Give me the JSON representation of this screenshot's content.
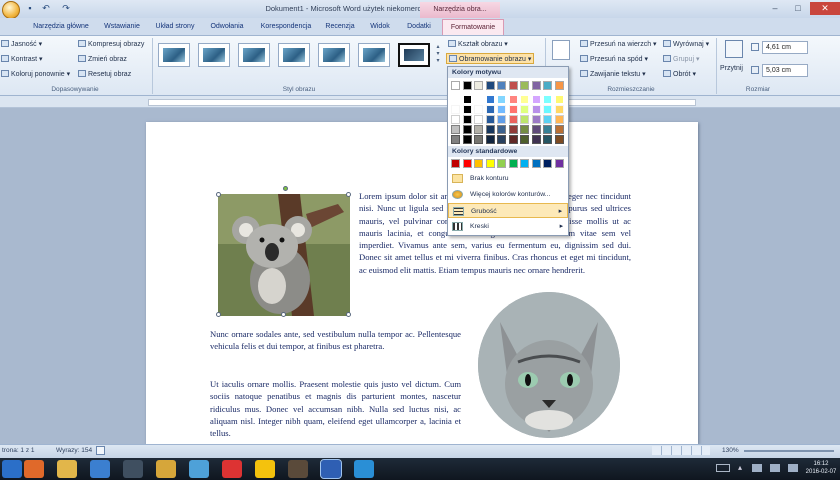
{
  "window": {
    "title": "Dokument1 - Microsoft Word użytek niekomercyjny",
    "context_title": "Narzędzia obra...",
    "colors": {
      "ribbon": "#dde7f3",
      "context_tab": "#fbe9f0",
      "close": "#c9463d",
      "document_text": "#1a2a66",
      "hover_menu": "#fde9b8"
    }
  },
  "tabs": [
    "Narzędzia główne",
    "Wstawianie",
    "Układ strony",
    "Odwołania",
    "Korespondencja",
    "Recenzja",
    "Widok",
    "Dodatki",
    "Formatowanie"
  ],
  "ribbon": {
    "adjust": {
      "brightness": "Jasność",
      "contrast": "Kontrast",
      "recolor": "Koloruj ponownie",
      "compress": "Kompresuj obrazy",
      "change": "Zmień obraz",
      "reset": "Resetuj obraz",
      "label": "Dopasowywanie"
    },
    "styles": {
      "label": "Styl obrazu"
    },
    "shape_border": {
      "shape": "Kształt obrazu",
      "border": "Obramowanie obrazu"
    },
    "arrange": {
      "bring_front": "Przesuń na wierzch",
      "send_back": "Przesuń na spód",
      "wrap": "Zawijanie tekstu",
      "align": "Wyrównaj",
      "group": "Grupuj",
      "rotate": "Obrót",
      "position": "Położenie",
      "label": "Rozmieszczanie"
    },
    "size": {
      "crop": "Przytnij",
      "height": "4,61 cm",
      "width": "5,03 cm",
      "label": "Rozmiar"
    }
  },
  "dropdown": {
    "theme_colors": "Kolory motywu",
    "standard_colors": "Kolory standardowe",
    "no_outline": "Brak konturu",
    "more_colors": "Więcej kolorów konturów...",
    "weight": "Grubość",
    "dashes": "Kreski",
    "theme_top": [
      "#ffffff",
      "#000000",
      "#eeece1",
      "#1f497d",
      "#4f81bd",
      "#c0504d",
      "#9bbb59",
      "#8064a2",
      "#4bacc6",
      "#f79646"
    ],
    "standard": [
      "#c00000",
      "#ff0000",
      "#ffc000",
      "#ffff00",
      "#92d050",
      "#00b050",
      "#00b0f0",
      "#0070c0",
      "#002060",
      "#7030a0"
    ]
  },
  "document": {
    "para1": [
      {
        "t": "Lorem ipsum dolor sit amet, consectetur adipiscing elit. Integer nec tincidunt nisi. Nunc ut ligula sed mauris in pulvinar condimentum, purus sed ultrices mauris, vel pulvinar convallis ante est eu risus. Suspendisse mollis ut ac mauris lacinia, et congue felis congue. Donec fermentum vitae sem vel imperdiet. Vivamus ante sem, varius eu fermentum eu, dignissim sed dui. Donec sit amet tellus et mi viverra finibus. Cras rhoncus et eget mi tincidunt, ac euismod elit mattis. Etiam tempus mauris nec ornare hendrerit."
      }
    ],
    "para1_cont": "Nunc ornare sodales ante, sed vestibulum nulla tempor ac. Pellentesque vehicula felis et dui tempor, at finibus est pharetra.",
    "para2": "Ut iaculis ornare mollis. Praesent molestie quis justo vel dictum. Cum sociis natoque penatibus et magnis dis parturient montes, nascetur ridiculus mus. Donec vel accumsan nibh. Nulla sed luctus nisi, ac aliquam nisl. Integer nibh quam, eleifend eget ullamcorper a, lacinia et tellus."
  },
  "status": {
    "page": "trona: 1 z 1",
    "words": "Wyrazy: 154",
    "zoom": "130%"
  },
  "taskbar": {
    "icons": [
      "start-icon",
      "firefox-icon",
      "explorer-icon",
      "display-icon",
      "terminal-icon",
      "files-icon",
      "app-m-icon",
      "opera-icon",
      "chrome-icon",
      "image-icon",
      "word-icon",
      "help-icon"
    ],
    "time": "16:12",
    "date": "2016-02-07"
  }
}
